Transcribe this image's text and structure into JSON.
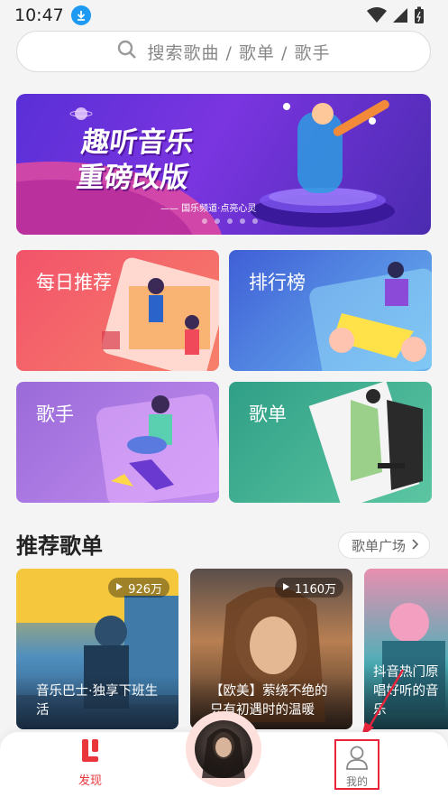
{
  "status_bar": {
    "time": "10:47"
  },
  "search": {
    "placeholder": "搜索歌曲 / 歌单 / 歌手"
  },
  "banner": {
    "title_line1": "趣听音乐",
    "title_line2": "重磅改版",
    "subtitle": "—— 国乐频道·点亮心灵"
  },
  "categories": [
    {
      "label": "每日推荐"
    },
    {
      "label": "排行榜"
    },
    {
      "label": "歌手"
    },
    {
      "label": "歌单"
    }
  ],
  "section": {
    "title": "推荐歌单",
    "more_label": "歌单广场"
  },
  "playlists": [
    {
      "count": "926万",
      "name": "音乐巴士·独享下班生活"
    },
    {
      "count": "1160万",
      "name": "【欧美】萦绕不绝的只有初遇时的温暖"
    },
    {
      "count": "",
      "name": "抖音热门原唱好听的音乐"
    }
  ],
  "bottom_nav": {
    "discover_label": "发现",
    "mine_label": "我的"
  },
  "colors": {
    "accent": "#e8363b",
    "highlight_box": "#e8243b"
  }
}
